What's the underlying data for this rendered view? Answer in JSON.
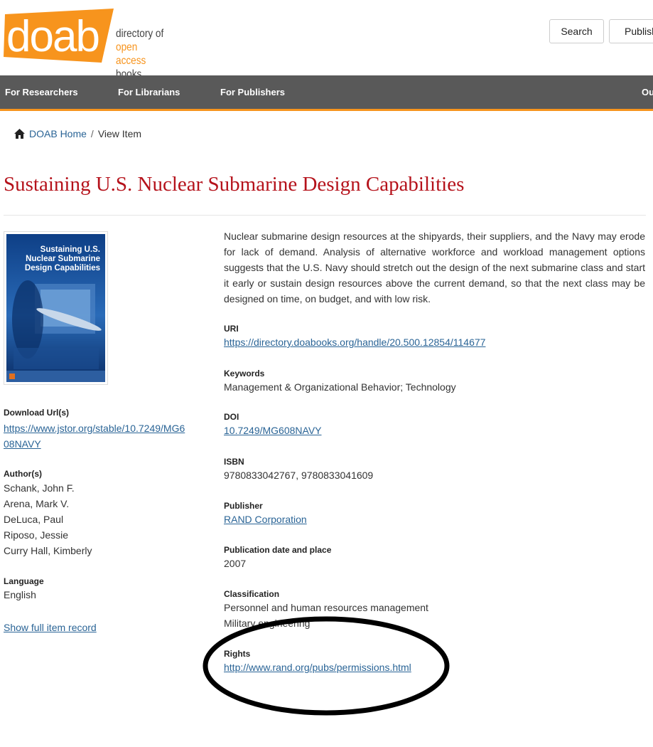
{
  "header": {
    "logo_word": "doab",
    "logo_tagline": [
      "directory of",
      "open access",
      "books"
    ],
    "search_label": "Search",
    "publish_label": "Publish"
  },
  "nav": {
    "items": [
      "For Researchers",
      "For Librarians",
      "For Publishers",
      "Ou"
    ]
  },
  "breadcrumb": {
    "home": "DOAB Home",
    "separator": "/",
    "current": "View Item"
  },
  "title": "Sustaining U.S. Nuclear Submarine Design Capabilities",
  "cover": {
    "title_lines": [
      "Sustaining U.S.",
      "Nuclear Submarine",
      "Design Capabilities"
    ]
  },
  "left": {
    "download_label": "Download Url(s)",
    "download_url_line1": "https://www.jstor.org/stable/10.7249/MG6",
    "download_url_line2": "08NAVY",
    "authors_label": "Author(s)",
    "authors": [
      "Schank, John F.",
      "Arena, Mark V.",
      "DeLuca, Paul",
      "Riposo, Jessie",
      "Curry Hall, Kimberly"
    ],
    "language_label": "Language",
    "language": "English",
    "full_record": "Show full item record"
  },
  "abstract": "Nuclear submarine design resources at the shipyards, their suppliers, and the Navy may erode for lack of demand. Analysis of alternative workforce and workload management options suggests that the U.S. Navy should stretch out the design of the next submarine class and start it early or sustain design resources above the current demand, so that the next class may be designed on time, on budget, and with low risk.",
  "fields": {
    "uri_label": "URI",
    "uri": "https://directory.doabooks.org/handle/20.500.12854/114677",
    "keywords_label": "Keywords",
    "keywords": "Management & Organizational Behavior; Technology",
    "doi_label": "DOI",
    "doi": "10.7249/MG608NAVY",
    "isbn_label": "ISBN",
    "isbn": "9780833042767, 9780833041609",
    "publisher_label": "Publisher",
    "publisher": "RAND Corporation",
    "pubdate_label": "Publication date and place",
    "pubdate": "2007",
    "classification_label": "Classification",
    "classification": [
      "Personnel and human resources management",
      "Military engineering"
    ],
    "rights_label": "Rights",
    "rights": "http://www.rand.org/pubs/permissions.html"
  },
  "colors": {
    "brand_orange": "#f7941d",
    "title_red": "#b5121b",
    "nav_bg": "#595959",
    "link": "#2a6496"
  }
}
